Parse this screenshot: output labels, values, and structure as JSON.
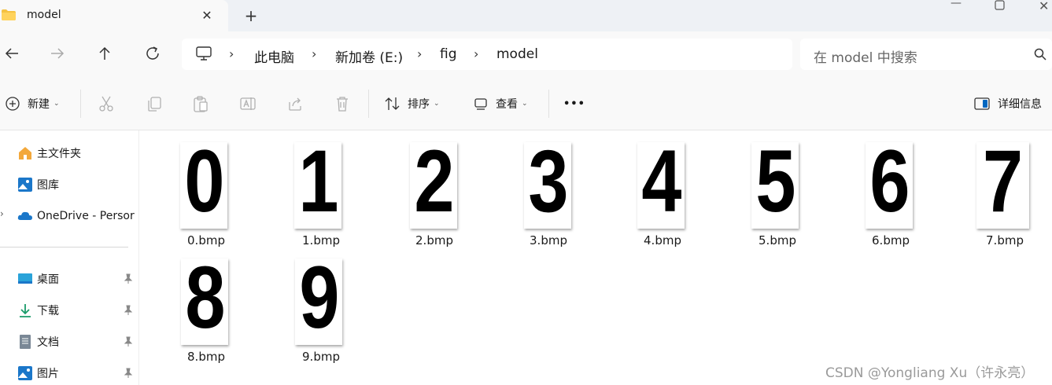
{
  "tab": {
    "title": "model",
    "close_icon": "close-icon",
    "folder_icon": "folder-icon"
  },
  "window_controls": {
    "minimize_icon": "minimize-icon",
    "maximize_icon": "maximize-icon",
    "close_icon": "close-icon"
  },
  "navigation": {
    "breadcrumb": [
      "此电脑",
      "新加卷 (E:)",
      "fig",
      "model"
    ],
    "search_placeholder": "在 model 中搜索"
  },
  "toolbar": {
    "new_label": "新建",
    "sort_label": "排序",
    "view_label": "查看",
    "more_label": "•••",
    "details_label": "详细信息"
  },
  "sidebar": {
    "items": [
      {
        "label": "主文件夹",
        "icon": "home-icon"
      },
      {
        "label": "图库",
        "icon": "gallery-icon"
      },
      {
        "label": "OneDrive - Persor",
        "icon": "cloud-icon"
      }
    ],
    "pinned": [
      {
        "label": "桌面",
        "icon": "desktop-icon"
      },
      {
        "label": "下载",
        "icon": "download-icon"
      },
      {
        "label": "文档",
        "icon": "document-icon"
      },
      {
        "label": "图片",
        "icon": "picture-icon"
      }
    ]
  },
  "files": [
    {
      "name": "0.bmp",
      "glyph": "0"
    },
    {
      "name": "1.bmp",
      "glyph": "1"
    },
    {
      "name": "2.bmp",
      "glyph": "2"
    },
    {
      "name": "3.bmp",
      "glyph": "3"
    },
    {
      "name": "4.bmp",
      "glyph": "4"
    },
    {
      "name": "5.bmp",
      "glyph": "5"
    },
    {
      "name": "6.bmp",
      "glyph": "6"
    },
    {
      "name": "7.bmp",
      "glyph": "7"
    },
    {
      "name": "8.bmp",
      "glyph": "8"
    },
    {
      "name": "9.bmp",
      "glyph": "9"
    }
  ],
  "watermark": "CSDN @Yongliang Xu（许永亮）",
  "colors": {
    "accent": "#0067c0",
    "folder": "#f5c242",
    "chrome": "#eef1f5",
    "toolbar_bg": "#f9f9f9"
  }
}
